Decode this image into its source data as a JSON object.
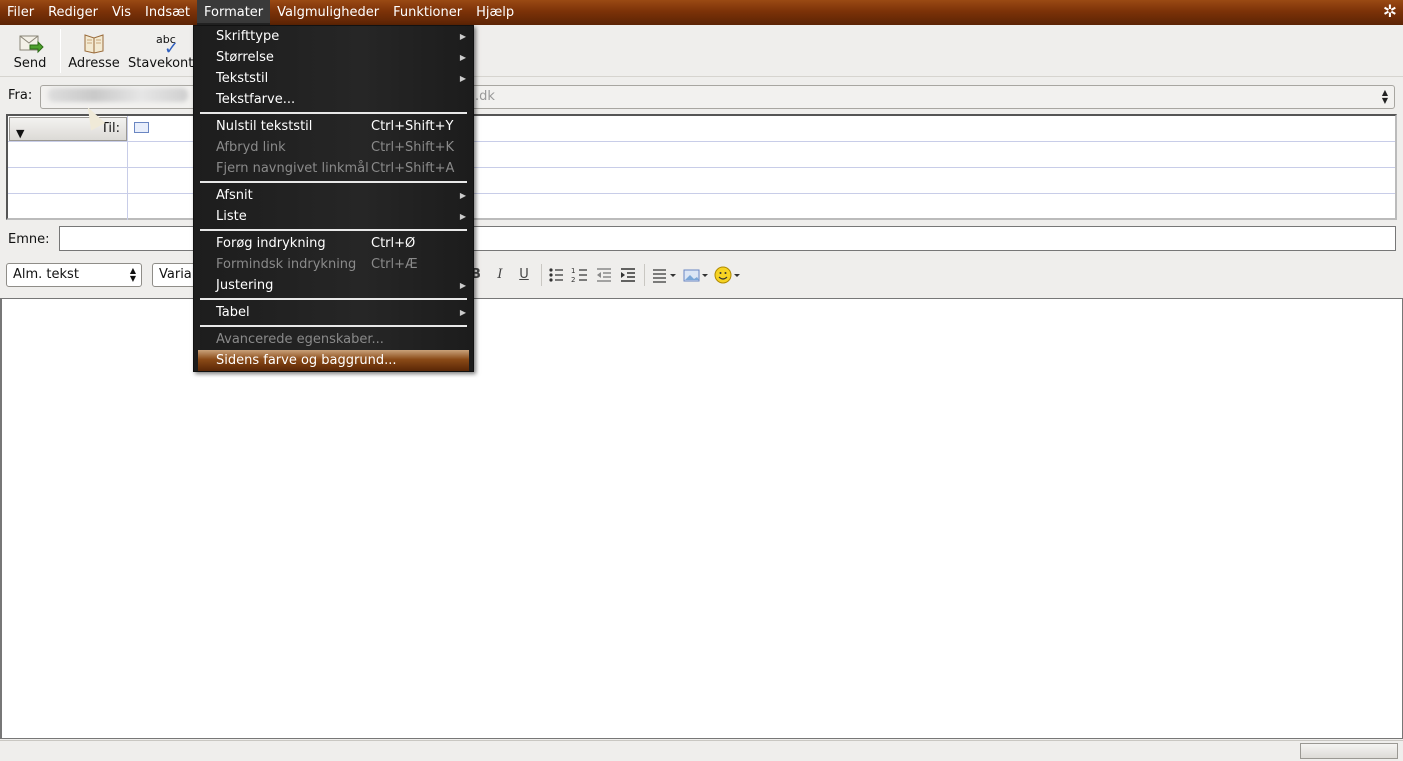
{
  "menubar": {
    "items": [
      "Filer",
      "Rediger",
      "Vis",
      "Indsæt",
      "Formater",
      "Valgmuligheder",
      "Funktioner",
      "Hjælp"
    ],
    "active": "Formater"
  },
  "toolbar": {
    "send_label": "Send",
    "address_label": "Adresse",
    "spell_label": "Stavekont",
    "spell_icon_text": "abc"
  },
  "from": {
    "label": "Fra:",
    "value_visible": ".dk"
  },
  "addressing": {
    "type_label": "Til:"
  },
  "subject": {
    "label": "Emne:",
    "value": ""
  },
  "format_bar": {
    "paragraph_style": "Alm. tekst",
    "font": "Varial",
    "bold": "B",
    "italic": "I",
    "underline": "U"
  },
  "format_menu": {
    "items": [
      {
        "label": "Skrifttype",
        "submenu": true
      },
      {
        "label": "Størrelse",
        "submenu": true
      },
      {
        "label": "Tekststil",
        "submenu": true
      },
      {
        "label": "Tekstfarve...",
        "submenu": false
      },
      {
        "label": "Nulstil tekststil",
        "shortcut": "Ctrl+Shift+Y"
      },
      {
        "label": "Afbryd link",
        "shortcut": "Ctrl+Shift+K",
        "disabled": true
      },
      {
        "label": "Fjern navngivet linkmål",
        "shortcut": "Ctrl+Shift+A",
        "disabled": true
      },
      {
        "label": "Afsnit",
        "submenu": true
      },
      {
        "label": "Liste",
        "submenu": true
      },
      {
        "label": "Forøg indrykning",
        "shortcut": "Ctrl+Ø"
      },
      {
        "label": "Formindsk indrykning",
        "shortcut": "Ctrl+Æ",
        "disabled": true
      },
      {
        "label": "Justering",
        "submenu": true
      },
      {
        "label": "Tabel",
        "submenu": true
      },
      {
        "label": "Avancerede egenskaber...",
        "disabled": true
      },
      {
        "label": "Sidens farve og baggrund...",
        "highlighted": true
      }
    ]
  },
  "colors": {
    "menubar_brown": "#7c3208",
    "menu_bg": "#222222",
    "highlight_brown": "#8a4a17"
  }
}
